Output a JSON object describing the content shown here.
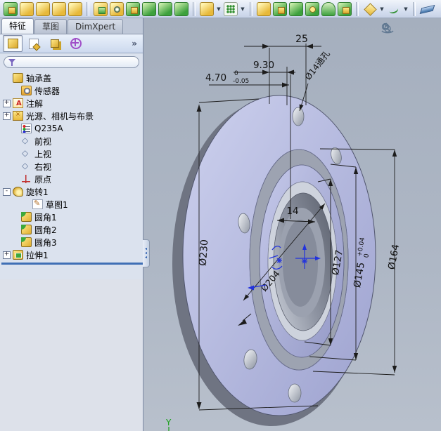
{
  "toolbar": {
    "icons": [
      "extruded-boss",
      "revolved-boss",
      "swept-boss",
      "lofted-boss",
      "boundary-boss",
      "extruded-cut",
      "hole-wizard",
      "revolved-cut",
      "swept-cut",
      "lofted-cut",
      "boundary-cut",
      "fillet",
      "linear-pattern",
      "draft",
      "shell",
      "rib",
      "wrap",
      "dome",
      "mirror",
      "reference-geometry",
      "curves",
      "instant3d"
    ]
  },
  "command_tabs": [
    {
      "label": "特征",
      "active": true
    },
    {
      "label": "草图",
      "active": false
    },
    {
      "label": "DimXpert",
      "active": false
    }
  ],
  "panel": {
    "more_chevron": "»",
    "manager_tabs": [
      "featuremanager-tree",
      "propertymanager",
      "configurationmanager",
      "dimxpertmanager"
    ]
  },
  "tree": {
    "items": [
      {
        "label": "轴承盖",
        "icon": "part-icon",
        "expand": ""
      },
      {
        "label": "传感器",
        "icon": "sensors-icon",
        "expand": ""
      },
      {
        "label": "注解",
        "icon": "annotations-icon",
        "expand": "+"
      },
      {
        "label": "光源、相机与布景",
        "icon": "lights-cameras-scene-icon",
        "expand": "+"
      },
      {
        "label": "Q235A",
        "icon": "material-icon",
        "expand": ""
      },
      {
        "label": "前视",
        "icon": "plane-icon",
        "expand": ""
      },
      {
        "label": "上视",
        "icon": "plane-icon",
        "expand": ""
      },
      {
        "label": "右视",
        "icon": "plane-icon",
        "expand": ""
      },
      {
        "label": "原点",
        "icon": "origin-icon",
        "expand": ""
      },
      {
        "label": "旋转1",
        "icon": "revolve-icon",
        "expand": "-"
      },
      {
        "label": "草图1",
        "icon": "sketch-icon",
        "expand": ""
      },
      {
        "label": "圆角1",
        "icon": "fillet-icon",
        "expand": ""
      },
      {
        "label": "圆角2",
        "icon": "fillet-icon",
        "expand": ""
      },
      {
        "label": "圆角3",
        "icon": "fillet-icon",
        "expand": ""
      },
      {
        "label": "拉伸1",
        "icon": "extrude-icon",
        "expand": "+"
      }
    ]
  },
  "dimensions": {
    "d25": "25",
    "d930": "9.30",
    "d470": {
      "main": "4.70",
      "tol_up": "0",
      "tol_dn": "-0.05"
    },
    "hole_callout": "Ø14通孔",
    "d14": "14",
    "d230": "Ø230",
    "d127": "Ø127",
    "d145": {
      "main": "Ø145",
      "tol_up": "+0.04",
      "tol_dn": "0"
    },
    "d164": "Ø164",
    "d204": "Ø204"
  },
  "view_tools": [
    "zoom-to-fit",
    "zoom-to-area",
    "rotate-view"
  ],
  "triad": {
    "y_label": "Y"
  },
  "colors": {
    "graphics_bg": "#a8b2c0",
    "model_face": "#b4b8dd",
    "sketch_blue": "#2233dd",
    "dimension_text": "#111111",
    "splitter_blue": "#3f6fb5"
  }
}
